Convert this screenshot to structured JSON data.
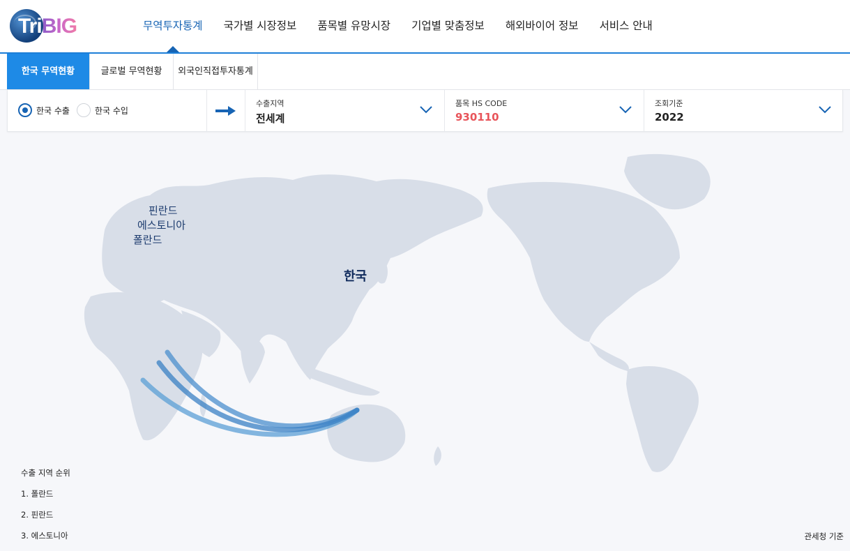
{
  "brand": {
    "logo_tri": "Tri",
    "logo_big": "BIG"
  },
  "gnb": [
    "무역투자통계",
    "국가별 시장정보",
    "품목별 유망시장",
    "기업별 맞춤정보",
    "해외바이어 정보",
    "서비스 안내"
  ],
  "tabs": [
    "한국 무역현황",
    "글로벌 무역현황",
    "외국인직접투자통계"
  ],
  "filter": {
    "radio_export": "한국 수출",
    "radio_import": "한국 수입",
    "selected_radio": "한국 수출",
    "region": {
      "label": "수출지역",
      "value": "전세계"
    },
    "hscode": {
      "label": "품목 HS CODE",
      "value": "930110"
    },
    "year": {
      "label": "조회기준",
      "value": "2022"
    }
  },
  "map": {
    "origin": "한국",
    "destinations": [
      "핀란드",
      "에스토니아",
      "폴란드"
    ]
  },
  "ranking": {
    "title": "수출 지역 순위",
    "items": [
      "1. 폴란드",
      "2. 핀란드",
      "3. 에스토니아"
    ]
  },
  "source_note": "관세청 기준",
  "colors": {
    "accent": "#1e8ae6",
    "nav_active": "#1764b4",
    "hscode": "#e8545a",
    "land": "#d8dee8",
    "arc": "#3a8fd0"
  }
}
